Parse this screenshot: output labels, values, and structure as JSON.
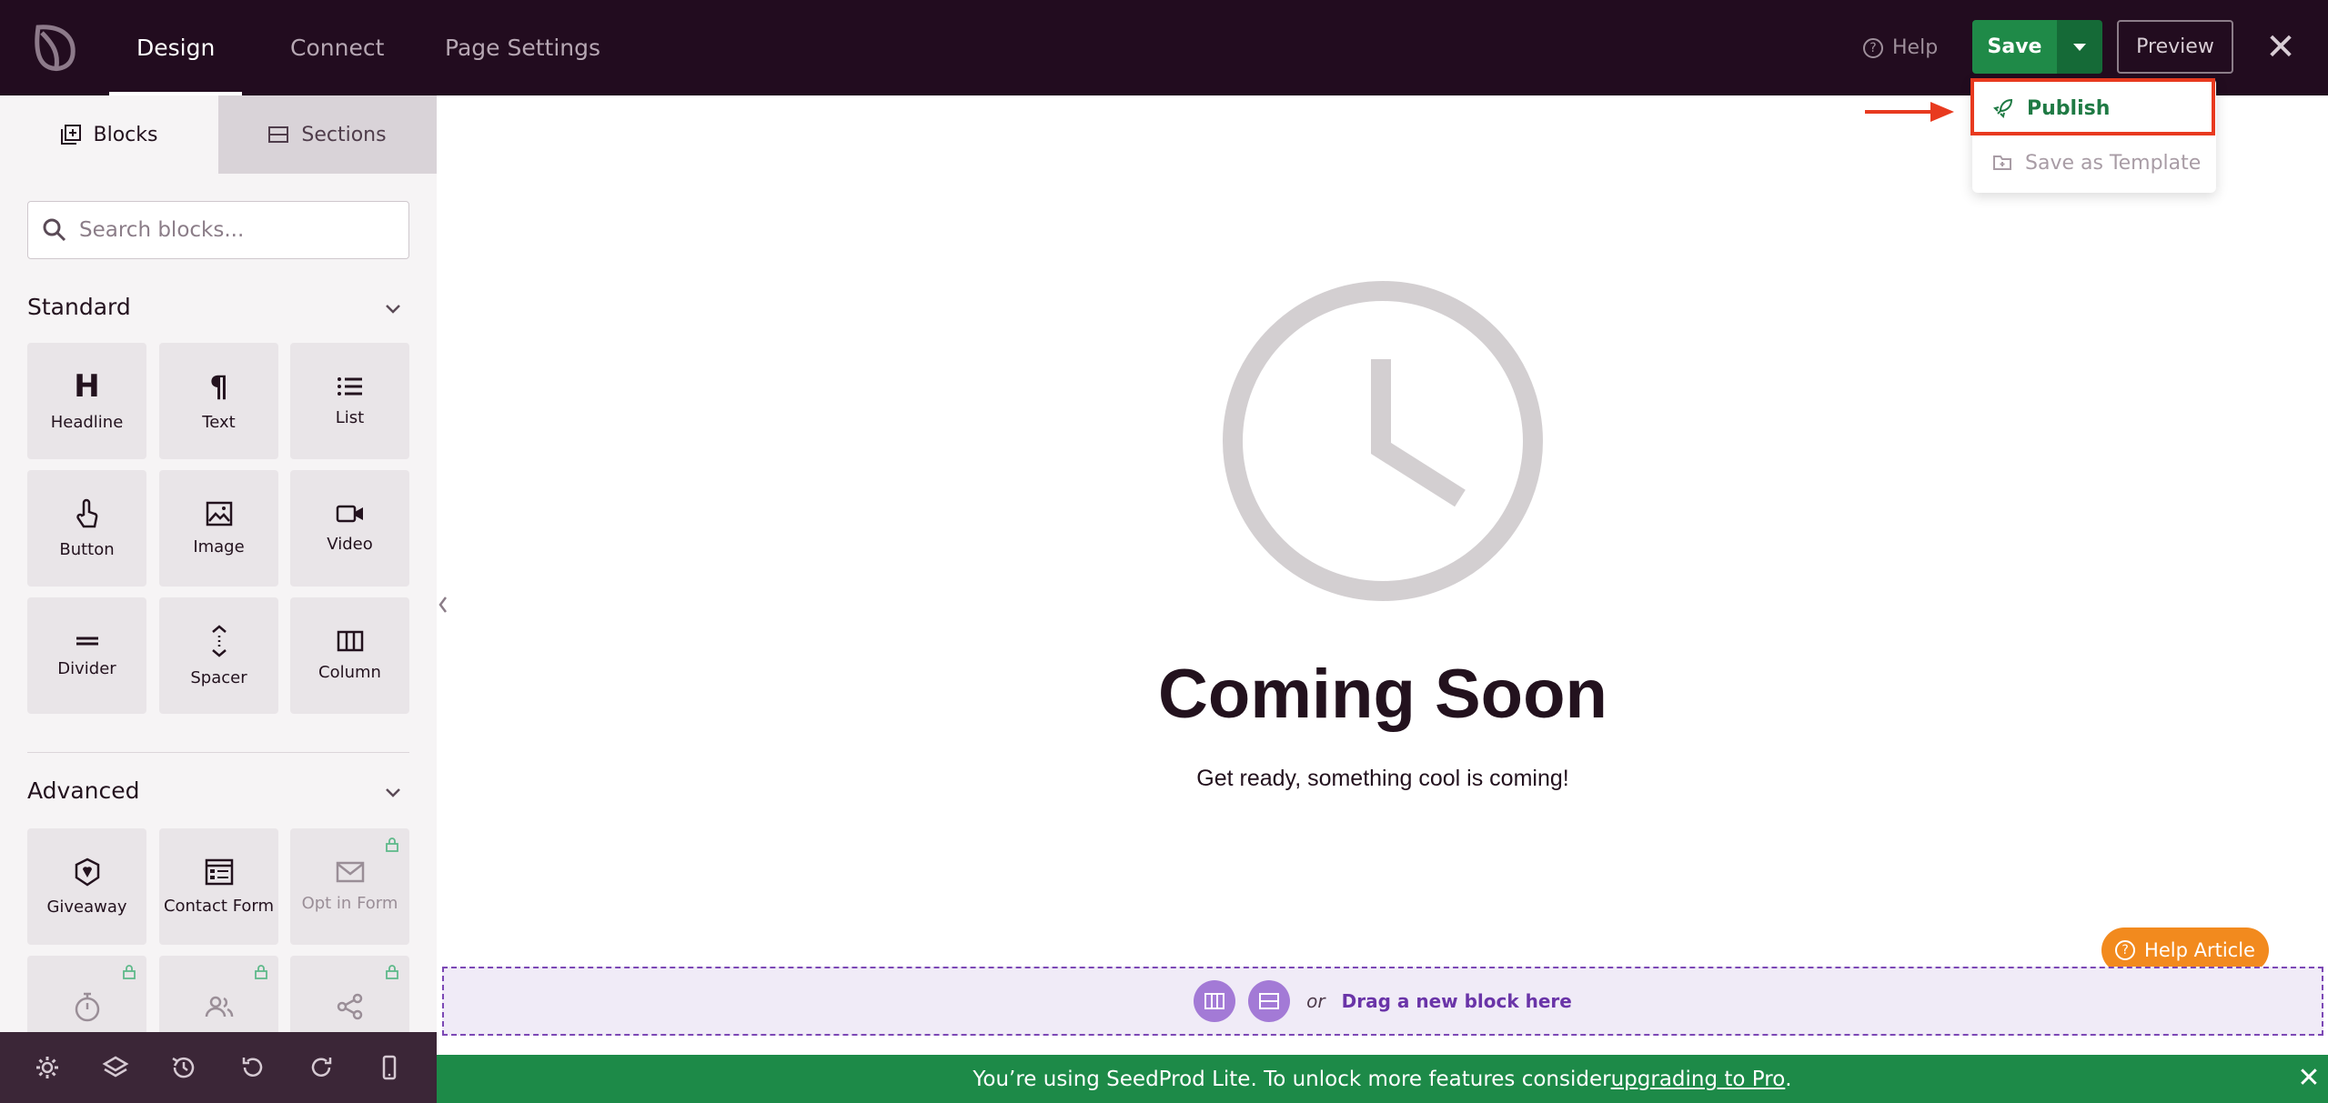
{
  "topbar": {
    "tabs": [
      {
        "label": "Design",
        "active": true
      },
      {
        "label": "Connect",
        "active": false
      },
      {
        "label": "Page Settings",
        "active": false
      }
    ],
    "help_label": "Help",
    "save_label": "Save",
    "preview_label": "Preview"
  },
  "save_menu": {
    "publish_label": "Publish",
    "template_label": "Save as Template"
  },
  "sidebar": {
    "tabs": [
      {
        "label": "Blocks",
        "icon": "blocks-icon",
        "active": true
      },
      {
        "label": "Sections",
        "icon": "sections-icon",
        "active": false
      }
    ],
    "search_placeholder": "Search blocks...",
    "standard": {
      "title": "Standard",
      "blocks": [
        {
          "label": "Headline",
          "icon": "headline-icon"
        },
        {
          "label": "Text",
          "icon": "paragraph-icon"
        },
        {
          "label": "List",
          "icon": "list-icon"
        },
        {
          "label": "Button",
          "icon": "pointer-hand-icon"
        },
        {
          "label": "Image",
          "icon": "image-icon"
        },
        {
          "label": "Video",
          "icon": "video-camera-icon"
        },
        {
          "label": "Divider",
          "icon": "divider-icon"
        },
        {
          "label": "Spacer",
          "icon": "spacer-icon"
        },
        {
          "label": "Column",
          "icon": "columns-icon"
        }
      ]
    },
    "advanced": {
      "title": "Advanced",
      "blocks": [
        {
          "label": "Giveaway",
          "icon": "giveaway-icon",
          "locked": false
        },
        {
          "label": "Contact Form",
          "icon": "contact-form-icon",
          "locked": false
        },
        {
          "label": "Opt in Form",
          "icon": "envelope-icon",
          "locked": true
        },
        {
          "label": "",
          "icon": "stopwatch-icon",
          "locked": true
        },
        {
          "label": "",
          "icon": "users-icon",
          "locked": true
        },
        {
          "label": "",
          "icon": "share-icon",
          "locked": true
        }
      ]
    }
  },
  "bottom_toolbar": [
    "gear-icon",
    "layers-icon",
    "history-icon",
    "undo-icon",
    "redo-icon",
    "mobile-preview-icon"
  ],
  "canvas": {
    "title": "Coming Soon",
    "subtitle": "Get ready, something cool is coming!",
    "drop_or": "or",
    "drop_text": "Drag a new block here"
  },
  "help_article_label": "Help Article",
  "banner": {
    "text_before": "You’re using SeedProd Lite. To unlock more features consider ",
    "link": "upgrading to Pro",
    "text_after": "."
  },
  "colors": {
    "topbar": "#220c1f",
    "save_green": "#1f8a48",
    "highlight_red": "#e83a1f",
    "drop_purple": "#7c48b5",
    "help_orange": "#f28a1e"
  }
}
